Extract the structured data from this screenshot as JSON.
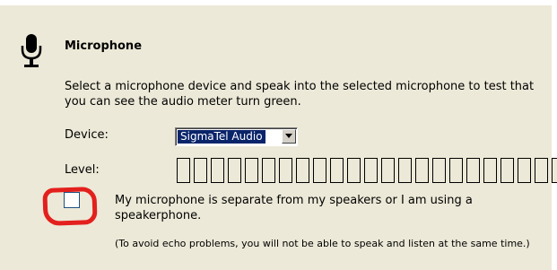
{
  "section": {
    "title": "Microphone",
    "description": "Select a microphone device and speak into the selected microphone to test that you can see the audio meter turn green."
  },
  "device": {
    "label": "Device:",
    "selected": "SigmaTel Audio"
  },
  "level": {
    "label": "Level:",
    "segments_total": 23,
    "segments_lit": 0
  },
  "separate_mic": {
    "checked": false,
    "label": "My microphone is separate from my speakers or I am using a speakerphone.",
    "note": "(To avoid echo problems, you will not be able to speak and listen at the same time.)"
  },
  "colors": {
    "panel_background": "#ece9d8",
    "selection_highlight": "#0a246a",
    "annotation_circle": "#e3201d",
    "meter_on": "#2fbf3f"
  },
  "icons": {
    "section_icon": "microphone-icon",
    "dropdown_icon": "chevron-down-icon"
  }
}
